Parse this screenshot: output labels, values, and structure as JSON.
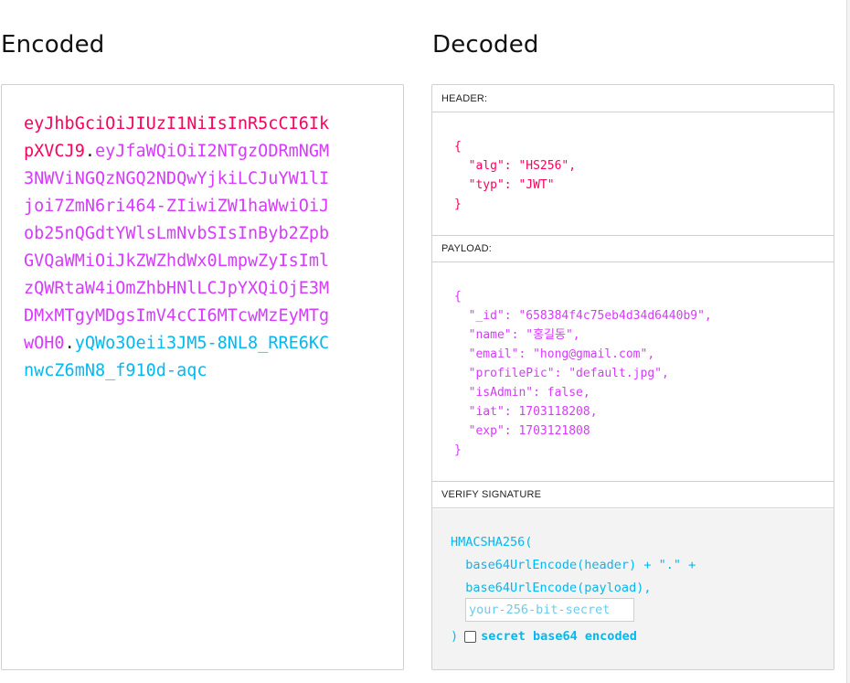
{
  "encoded": {
    "title": "Encoded",
    "header_part": "eyJhbGciOiJIUzI1NiIsInR5cCI6IkpXVCJ9",
    "payload_part": "eyJfaWQiOiI2NTgzODRmNGM3NWViNGQzNGQ2NDQwYjkiLCJuYW1lIjoi7ZmN6ri464-ZIiwiZW1haWwiOiJob25nQGdtYWlsLmNvbSIsInByb2ZpbGVQaWMiOiJkZWZhdWx0LmpwZyIsImlzQWRtaW4iOmZhbHNlLCJpYXQiOjE3MDMxMTgyMDgsImV4cCI6MTcwMzEyMTgwOH0",
    "signature_part": "yQWo3Oeii3JM5-8NL8_RRE6KCnwcZ6mN8_f910d-aqc",
    "dot": "."
  },
  "decoded": {
    "title": "Decoded",
    "header": {
      "label": "HEADER:",
      "lines": [
        "{",
        "  \"alg\": \"HS256\",",
        "  \"typ\": \"JWT\"",
        "}"
      ]
    },
    "payload": {
      "label": "PAYLOAD:",
      "lines": [
        "{",
        "  \"_id\": \"658384f4c75eb4d34d6440b9\",",
        "  \"name\": \"홍길동\",",
        "  \"email\": \"hong@gmail.com\",",
        "  \"profilePic\": \"default.jpg\",",
        "  \"isAdmin\": false,",
        "  \"iat\": 1703118208,",
        "  \"exp\": 1703121808",
        "}"
      ]
    },
    "signature": {
      "label": "VERIFY SIGNATURE",
      "fn": "HMACSHA256(",
      "line1": "  base64UrlEncode(header) + \".\" +",
      "line2": "  base64UrlEncode(payload),",
      "secret_placeholder": "your-256-bit-secret",
      "secret_value": "",
      "close": ")",
      "base64_label": "secret base64 encoded",
      "base64_checked": false
    }
  },
  "colors": {
    "header": "#fb015b",
    "payload": "#d63aff",
    "signature": "#00b9f1"
  }
}
